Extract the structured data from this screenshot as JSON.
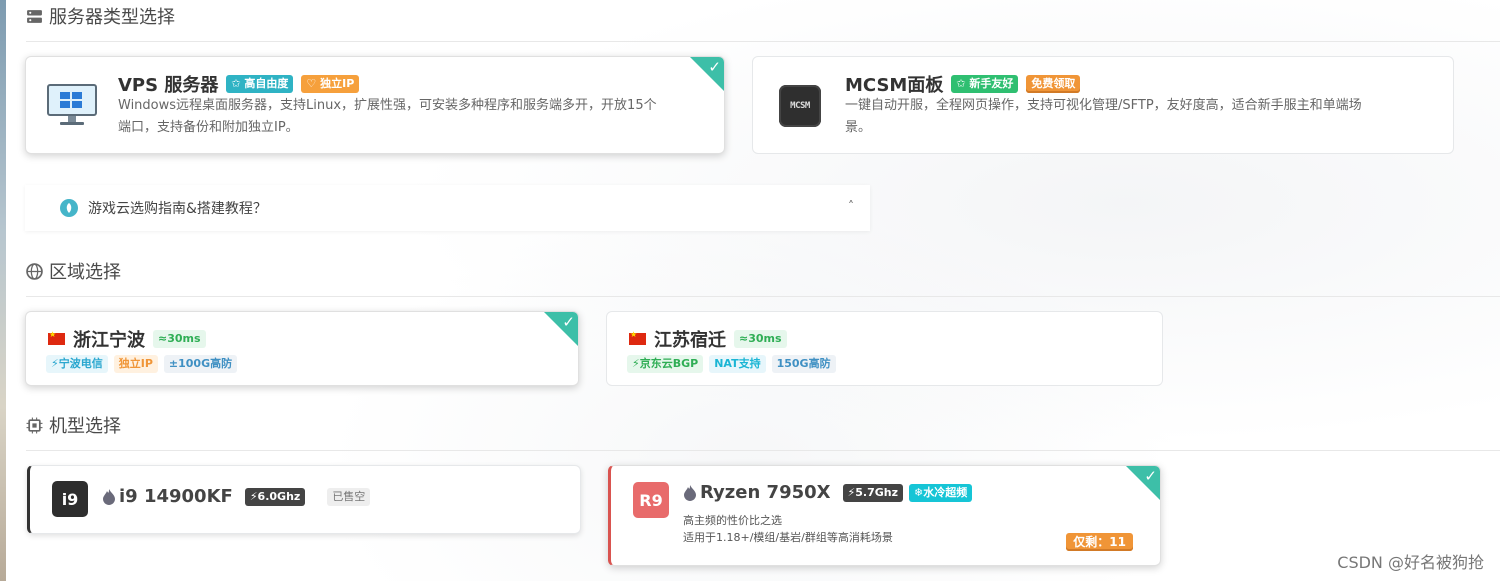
{
  "sections": {
    "server_type": "服务器类型选择",
    "region": "区域选择",
    "model": "机型选择"
  },
  "server_cards": [
    {
      "title": "VPS 服务器",
      "badges": [
        "✩ 高自由度",
        "♡ 独立IP"
      ],
      "desc_line1": "Windows远程桌面服务器，支持Linux，扩展性强，可安装多种程序和服务端多开，开放15个",
      "desc_line2": "端口，支持备份和附加独立IP。",
      "selected": true
    },
    {
      "title": "MCSM面板",
      "logo_text": "MCSM",
      "badges": [
        "✩ 新手友好",
        "免费领取"
      ],
      "desc_line1": "一键自动开服，全程网页操作，支持可视化管理/SFTP，友好度高，适合新手服主和单端场",
      "desc_line2": "景。",
      "selected": false
    }
  ],
  "guide": {
    "label": "游戏云选购指南&搭建教程？"
  },
  "region_cards": [
    {
      "name": "浙江宁波",
      "latency": "≈30ms",
      "tags": [
        "⚡宁波电信",
        "独立IP",
        "±100G高防"
      ],
      "selected": true
    },
    {
      "name": "江苏宿迁",
      "latency": "≈30ms",
      "tags": [
        "⚡京东云BGP",
        "NAT支持",
        "150G高防"
      ],
      "selected": false
    }
  ],
  "model_cards": [
    {
      "logo": "i9",
      "name": "i9 14900KF",
      "freq": "⚡6.0Ghz",
      "status": "已售空",
      "selected": false
    },
    {
      "logo": "R9",
      "name": "Ryzen 7950X",
      "freq": "⚡5.7Ghz",
      "cooling": "❄水冷超频",
      "desc1": "高主频的性价比之选",
      "desc2": "适用于1.18+/模组/基岩/群组等高消耗场景",
      "stock": "仅剩：11",
      "selected": true
    }
  ],
  "watermark": "CSDN @好名被狗抢",
  "colors": {
    "accent_teal": "#3dbfa8",
    "badge_teal": "#2fb3c4",
    "badge_orange": "#f6a03c",
    "r9_red": "#e86b6b"
  }
}
